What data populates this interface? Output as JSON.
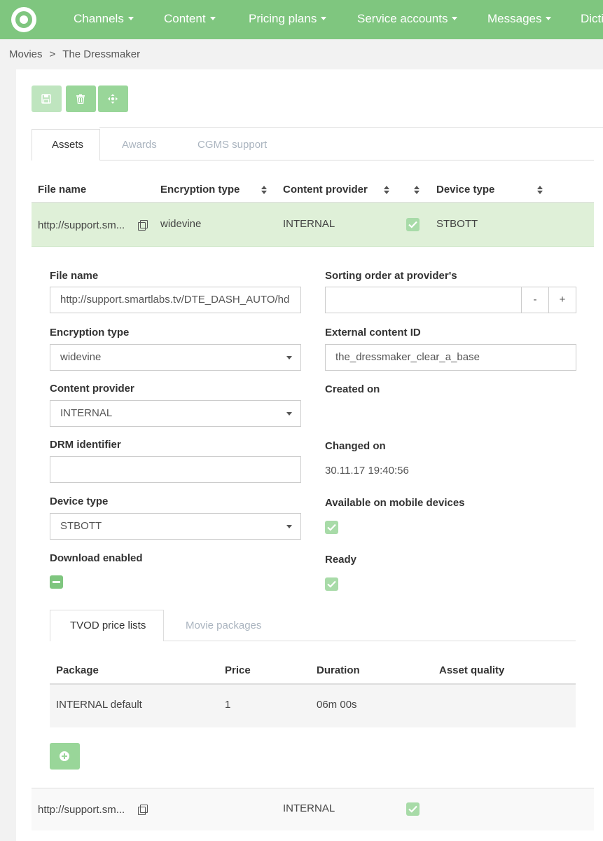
{
  "nav": {
    "items": [
      {
        "label": "Channels"
      },
      {
        "label": "Content"
      },
      {
        "label": "Pricing plans"
      },
      {
        "label": "Service accounts"
      },
      {
        "label": "Messages"
      },
      {
        "label": "Dicti"
      }
    ]
  },
  "breadcrumb": {
    "parent": "Movies",
    "separator": ">",
    "current": "The Dressmaker"
  },
  "toolbar": {
    "icons": [
      "save-icon",
      "trash-icon",
      "move-icon"
    ]
  },
  "tabs": [
    {
      "label": "Assets",
      "active": true
    },
    {
      "label": "Awards",
      "active": false
    },
    {
      "label": "CGMS support",
      "active": false
    }
  ],
  "assets_table": {
    "headers": [
      "File name",
      "Encryption type",
      "Content provider",
      "",
      "Device type"
    ],
    "rows": [
      {
        "file_name": "http://support.sm...",
        "encryption": "widevine",
        "provider": "INTERNAL",
        "checked": true,
        "device": "STBOTT"
      },
      {
        "file_name": "http://support.sm...",
        "encryption": "",
        "provider": "INTERNAL",
        "checked": true,
        "device": ""
      }
    ]
  },
  "form": {
    "file_name_label": "File name",
    "file_name_value": "http://support.smartlabs.tv/DTE_DASH_AUTO/hd",
    "sorting_label": "Sorting order at provider's",
    "sorting_value": "",
    "minus": "-",
    "plus": "+",
    "encryption_label": "Encryption type",
    "encryption_value": "widevine",
    "external_id_label": "External content ID",
    "external_id_value": "the_dressmaker_clear_a_base",
    "provider_label": "Content provider",
    "provider_value": "INTERNAL",
    "created_label": "Created on",
    "drm_label": "DRM identifier",
    "drm_value": "",
    "changed_label": "Changed on",
    "changed_value": "30.11.17 19:40:56",
    "device_label": "Device type",
    "device_value": "STBOTT",
    "mobile_label": "Available on mobile devices",
    "mobile_checked": true,
    "download_label": "Download enabled",
    "download_state": "indeterminate",
    "ready_label": "Ready",
    "ready_checked": true
  },
  "subtabs": [
    {
      "label": "TVOD price lists",
      "active": true
    },
    {
      "label": "Movie packages",
      "active": false
    }
  ],
  "price_table": {
    "headers": [
      "Package",
      "Price",
      "Duration",
      "Asset quality"
    ],
    "rows": [
      {
        "package": "INTERNAL default",
        "price": "1",
        "duration": "06m 00s",
        "quality": ""
      }
    ]
  },
  "colors": {
    "accent": "#7fc67f",
    "selected_row": "#dff0d8",
    "button": "#99d699"
  }
}
